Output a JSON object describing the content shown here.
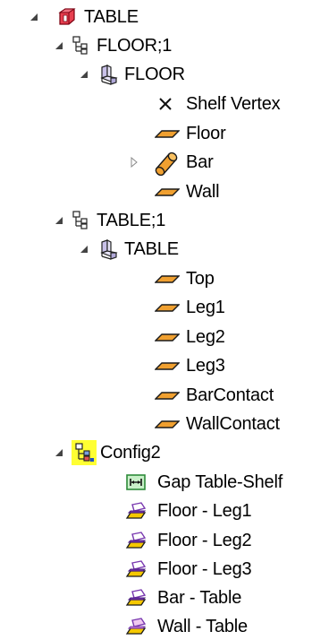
{
  "tree": {
    "root": {
      "label": "TABLE",
      "icon": "assembly-icon",
      "children": [
        {
          "label": "FLOOR;1",
          "icon": "subassembly-instance-icon",
          "part": {
            "label": "FLOOR",
            "icon": "part-icon",
            "items": [
              {
                "label": "Shelf Vertex",
                "icon": "vertex-icon"
              },
              {
                "label": "Floor",
                "icon": "face-icon"
              },
              {
                "label": "Bar",
                "icon": "cylinder-icon",
                "collapsed": true
              },
              {
                "label": "Wall",
                "icon": "face-icon"
              }
            ]
          }
        },
        {
          "label": "TABLE;1",
          "icon": "subassembly-instance-icon",
          "part": {
            "label": "TABLE",
            "icon": "part-icon",
            "items": [
              {
                "label": "Top",
                "icon": "face-icon"
              },
              {
                "label": "Leg1",
                "icon": "face-icon"
              },
              {
                "label": "Leg2",
                "icon": "face-icon"
              },
              {
                "label": "Leg3",
                "icon": "face-icon"
              },
              {
                "label": "BarContact",
                "icon": "face-icon"
              },
              {
                "label": "WallContact",
                "icon": "face-icon"
              }
            ]
          }
        }
      ]
    },
    "config": {
      "label": "Config2",
      "icon": "configuration-icon",
      "constraints": [
        {
          "label": "Gap Table-Shelf",
          "icon": "gap-constraint-icon"
        },
        {
          "label": "Floor - Leg1",
          "icon": "contact-constraint-icon"
        },
        {
          "label": "Floor - Leg2",
          "icon": "contact-constraint-icon"
        },
        {
          "label": "Floor - Leg3",
          "icon": "contact-constraint-icon"
        },
        {
          "label": "Bar - Table",
          "icon": "contact-constraint-icon"
        },
        {
          "label": "Wall - Table",
          "icon": "contact-constraint-pink-icon"
        }
      ]
    }
  },
  "colors": {
    "face_fill": "#f0a030",
    "face_stroke": "#1a1a1a",
    "assembly_red": "#d42030",
    "config_highlight": "#ffff33",
    "gap_green": "#2e8b3a",
    "contact_purple": "#7a3ab0",
    "contact_yellow": "#f5c800",
    "contact_pink": "#d080d0",
    "expander": "#444444"
  }
}
